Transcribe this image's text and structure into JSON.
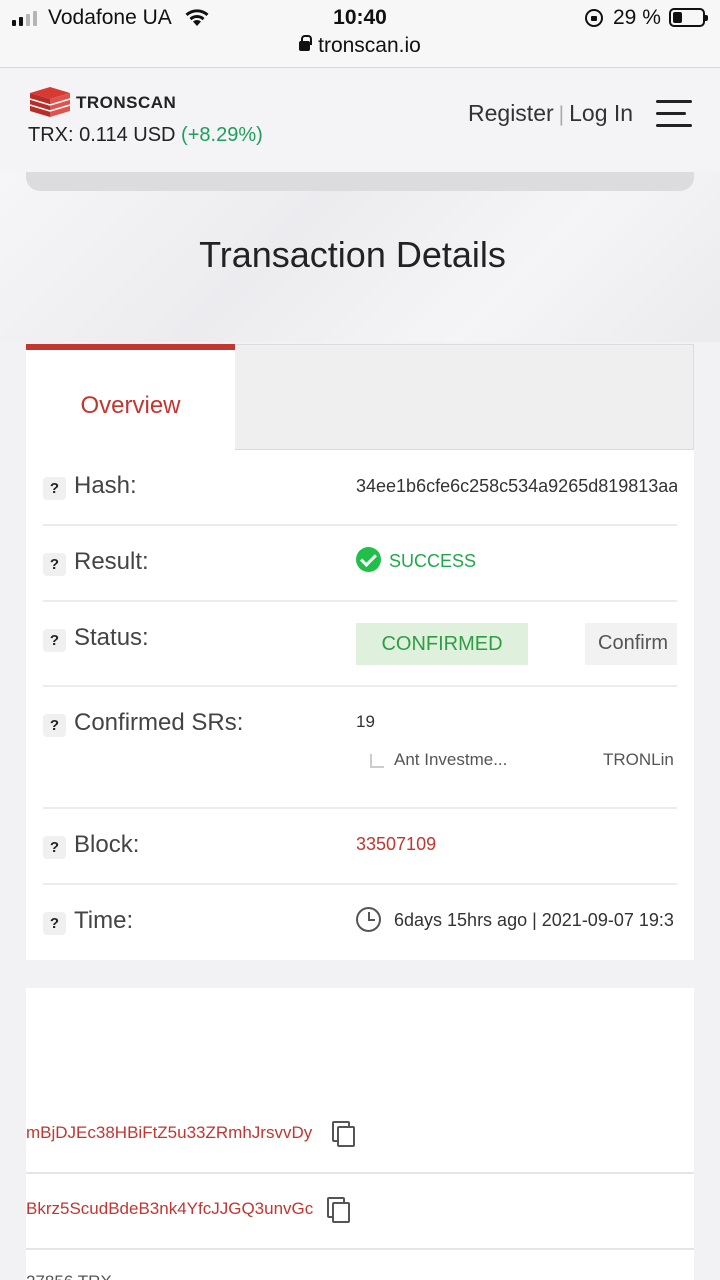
{
  "status_bar": {
    "carrier": "Vodafone UA",
    "time": "10:40",
    "url": "tronscan.io",
    "battery": "29 %"
  },
  "header": {
    "logo_text": "TRONSCAN",
    "price_label": "TRX:",
    "price_value": "0.114 USD",
    "price_change": "(+8.29%)",
    "register": "Register",
    "separator": "|",
    "login": "Log In"
  },
  "page": {
    "title": "Transaction Details"
  },
  "tabs": {
    "overview": "Overview"
  },
  "details": {
    "help": "?",
    "hash_label": "Hash:",
    "hash_value": "34ee1b6cfe6c258c534a9265d819813aa",
    "result_label": "Result:",
    "result_value": "SUCCESS",
    "status_label": "Status:",
    "status_value": "CONFIRMED",
    "status_next": "Confirm",
    "confirmed_srs_label": "Confirmed SRs:",
    "confirmed_srs_count": "19",
    "sr_list": [
      "Ant Investme...",
      "TRONLin"
    ],
    "block_label": "Block:",
    "block_value": "33507109",
    "time_label": "Time:",
    "time_value": "6days 15hrs ago | 2021-09-07 19:3"
  },
  "transfer": {
    "from_address": "mBjDJEc38HBiFtZ5u33ZRmhJrsvvDy",
    "to_address": "Bkrz5ScudBdeB3nk4YfcJJGQ3unvGc",
    "amount_partial": "27856 TRX"
  },
  "colors": {
    "brand_red": "#c23631",
    "success_green": "#1fbf4a",
    "price_green": "#1e9e5a"
  }
}
